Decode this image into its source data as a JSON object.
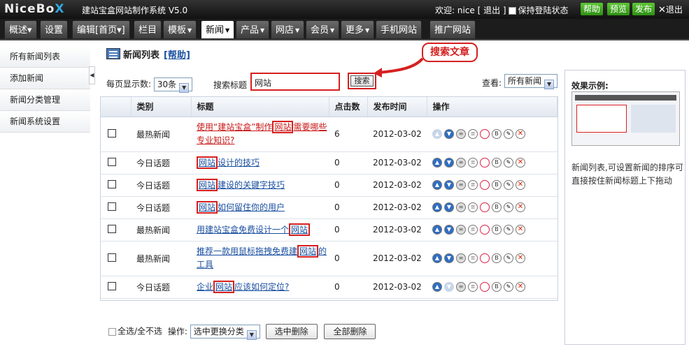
{
  "topbar": {
    "logo_a": "NiceBo",
    "logo_b": "X",
    "app_title": "建站宝盒网站制作系统 V5.0",
    "welcome": "欢迎: nice",
    "logout": "[ 退出 ]",
    "keep_login": "保持登陆状态",
    "help": "帮助",
    "preview": "预览",
    "publish": "发布",
    "exit": "退出"
  },
  "nav": {
    "tabs": [
      "概述▾",
      "设置",
      "编辑[首页▾]",
      "栏目",
      "模板",
      "新闻",
      "产品",
      "网店",
      "会员",
      "更多",
      "手机网站",
      "推广网站"
    ]
  },
  "sidebar": {
    "items": [
      "所有新闻列表",
      "添加新闻",
      "新闻分类管理",
      "新闻系统设置"
    ]
  },
  "main": {
    "heading": "新闻列表",
    "help": "[帮助]",
    "perpage_label": "每页显示数:",
    "perpage_value": "30条",
    "search_label": "搜索标题",
    "search_value": "网站",
    "search_button": "搜索",
    "callout": "搜索文章",
    "view_label": "查看:",
    "view_value": "所有新闻",
    "columns": [
      "类别",
      "标题",
      "点击数",
      "发布时间",
      "操作"
    ],
    "rows": [
      {
        "category": "最热新闻",
        "title_pre": "使用“建站宝盒”制作",
        "title_hl": "网站",
        "title_post": "需要哪些专业知识?",
        "clicks": "6",
        "date": "2012-03-02"
      },
      {
        "category": "今日话题",
        "title_pre": "",
        "title_hl": "网站",
        "title_post": "设计的技巧",
        "clicks": "0",
        "date": "2012-03-02"
      },
      {
        "category": "今日话题",
        "title_pre": "",
        "title_hl": "网站",
        "title_post": "建设的关键字技巧",
        "clicks": "0",
        "date": "2012-03-02"
      },
      {
        "category": "今日话题",
        "title_pre": "",
        "title_hl": "网站",
        "title_post": "如何留住你的用户",
        "clicks": "0",
        "date": "2012-03-02"
      },
      {
        "category": "最热新闻",
        "title_pre": "用建站宝盒免费设计一个",
        "title_hl": "网站",
        "title_post": "",
        "clicks": "0",
        "date": "2012-03-02"
      },
      {
        "category": "最热新闻",
        "title_pre": "推荐一款用鼠标拖拽免费建",
        "title_hl": "网站",
        "title_post": "的工具",
        "clicks": "0",
        "date": "2012-03-02"
      },
      {
        "category": "今日话题",
        "title_pre": "企业",
        "title_hl": "网站",
        "title_post": "应该如何定位?",
        "clicks": "0",
        "date": "2012-03-02"
      }
    ],
    "select_all": "全选/全不选",
    "op_label": "操作:",
    "op_value": "选中更换分类",
    "delete_selected": "选中删除",
    "delete_all": "全部删除"
  },
  "right_panel": {
    "title": "效果示例:",
    "description": "新闻列表,可设置新闻的排序可直接按住新闻标题上下拖动"
  }
}
